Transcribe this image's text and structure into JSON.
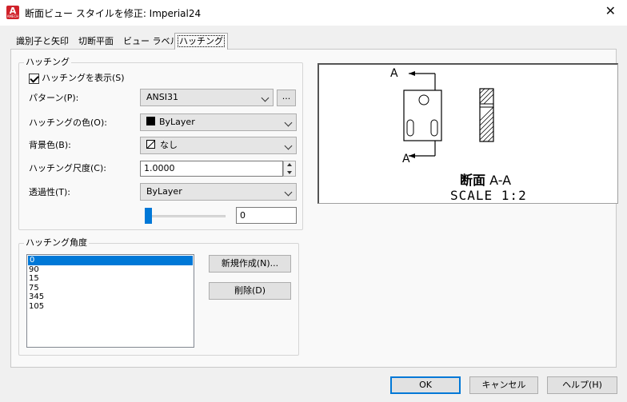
{
  "window": {
    "title": "断面ビュー スタイルを修正: Imperial24",
    "app_icon_letter": "A",
    "app_icon_sub": "AMECH"
  },
  "tabs": [
    {
      "label": "識別子と矢印",
      "active": false
    },
    {
      "label": "切断平面",
      "active": false
    },
    {
      "label": "ビュー ラベル",
      "active": false
    },
    {
      "label": "ハッチング",
      "active": true
    }
  ],
  "hatching": {
    "group_title": "ハッチング",
    "show_hatching_label": "ハッチングを表示(S)",
    "show_hatching_checked": true,
    "pattern_label": "パターン(P):",
    "pattern_value": "ANSI31",
    "pattern_browse_label": "...",
    "color_label": "ハッチングの色(O):",
    "color_value": "ByLayer",
    "background_label": "背景色(B):",
    "background_value": "なし",
    "scale_label": "ハッチング尺度(C):",
    "scale_value": "1.0000",
    "transparency_label": "透過性(T):",
    "transparency_value": "ByLayer",
    "transparency_level": "0",
    "slider_fraction": 0.0
  },
  "angles": {
    "group_title": "ハッチング角度",
    "items": [
      "0",
      "90",
      "15",
      "75",
      "345",
      "105"
    ],
    "selected_index": 0,
    "new_button": "新規作成(N)...",
    "delete_button": "削除(D)"
  },
  "preview": {
    "label_top": "A",
    "label_bottom": "A",
    "title_bold": "断面",
    "title_rest": " A-A",
    "scale": "SCALE 1:2"
  },
  "footer": {
    "ok": "OK",
    "cancel": "キャンセル",
    "help": "ヘルプ(H)"
  },
  "colors": {
    "accent": "#0078d7",
    "app_icon": "#d0222a"
  }
}
